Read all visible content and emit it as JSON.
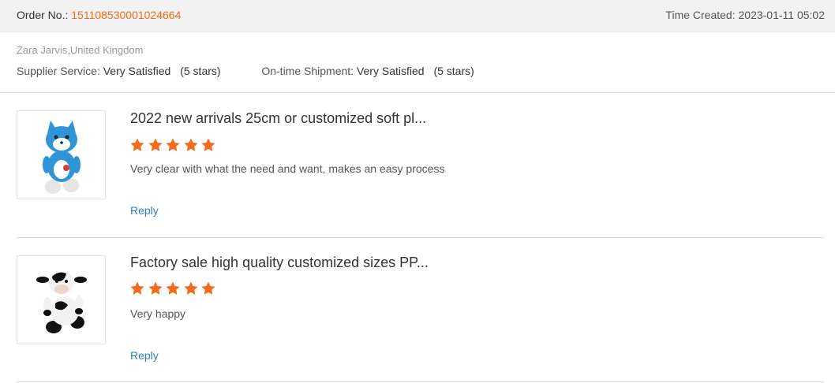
{
  "order": {
    "label": "Order No.:",
    "number": "151108530001024664",
    "time_created_label": "Time Created:",
    "time_created": "2023-01-11 05:02"
  },
  "buyer": {
    "name": "Zara Jarvis,United Kingdom",
    "supplier_service_label": "Supplier Service:",
    "supplier_service_value": "Very Satisfied",
    "supplier_service_stars": "(5 stars)",
    "shipment_label": "On-time Shipment:",
    "shipment_value": "Very Satisfied",
    "shipment_stars": "(5 stars)"
  },
  "colors": {
    "accent": "#f56a1c",
    "star": "#f56a1c",
    "link": "#2f7fc1"
  },
  "reviews": [
    {
      "title": "2022 new arrivals 25cm or customized soft pl...",
      "rating": 5,
      "comment": "Very clear with what the need and want, makes an easy process",
      "reply_label": "Reply",
      "thumbnail": "blue-cat-plush-image"
    },
    {
      "title": "Factory sale high quality customized sizes PP...",
      "rating": 5,
      "comment": "Very happy",
      "reply_label": "Reply",
      "thumbnail": "cow-plush-image"
    }
  ]
}
